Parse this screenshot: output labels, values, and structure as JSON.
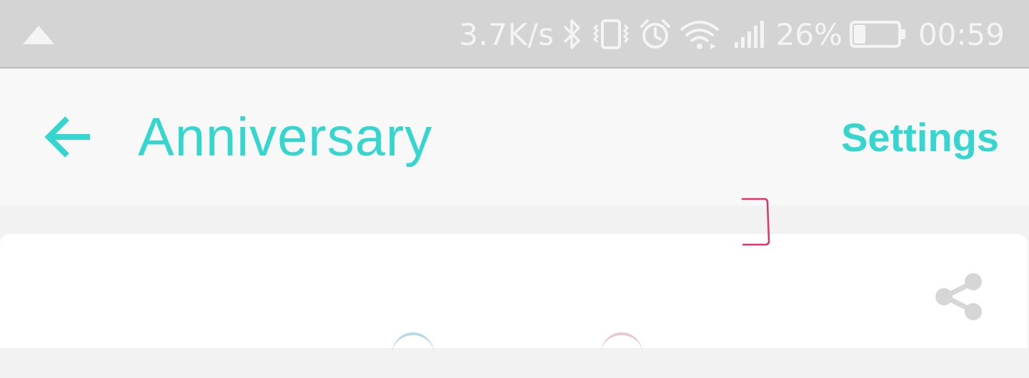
{
  "status_bar": {
    "network_speed": "3.7K/s",
    "battery_percent": "26%",
    "battery_level": 0.26,
    "time": "00:59",
    "icons": [
      "nav-up-icon",
      "bluetooth-icon",
      "vibrate-icon",
      "alarm-icon",
      "wifi-icon",
      "signal-icon",
      "battery-icon"
    ]
  },
  "app_bar": {
    "title": "Anniversary",
    "back_icon": "arrow-left-icon",
    "settings_label": "Settings"
  },
  "card": {
    "share_icon": "share-icon"
  },
  "colors": {
    "accent": "#35d6cf",
    "status_bar_bg": "#d4d4d4",
    "app_bar_bg": "#f8f8f8",
    "page_bg": "#f2f2f2",
    "card_bg": "#ffffff",
    "share_icon": "#d6d6d6",
    "annotation": "#e0336e"
  }
}
